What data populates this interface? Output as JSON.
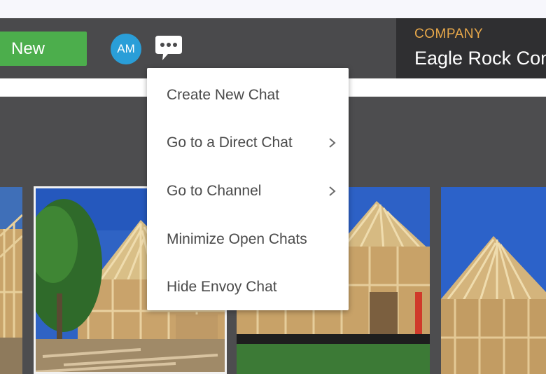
{
  "toolbar": {
    "new_button": "New",
    "avatar_initials": "AM",
    "chat_icon": "chat-bubble-ellipsis-icon",
    "new_button_color": "#4cae4c",
    "avatar_color": "#2a9ed8"
  },
  "company": {
    "label": "COMPANY",
    "name": "Eagle Rock Con",
    "label_color": "#e8a84a"
  },
  "chat_menu": {
    "items": [
      {
        "label": "Create New Chat",
        "has_submenu": false
      },
      {
        "label": "Go to a Direct Chat",
        "has_submenu": true
      },
      {
        "label": "Go to Channel",
        "has_submenu": true
      },
      {
        "label": "Minimize Open Chats",
        "has_submenu": false
      },
      {
        "label": "Hide Envoy Chat",
        "has_submenu": false
      }
    ]
  },
  "photos": {
    "subject": "construction-house-framing",
    "selected_index": 1
  }
}
